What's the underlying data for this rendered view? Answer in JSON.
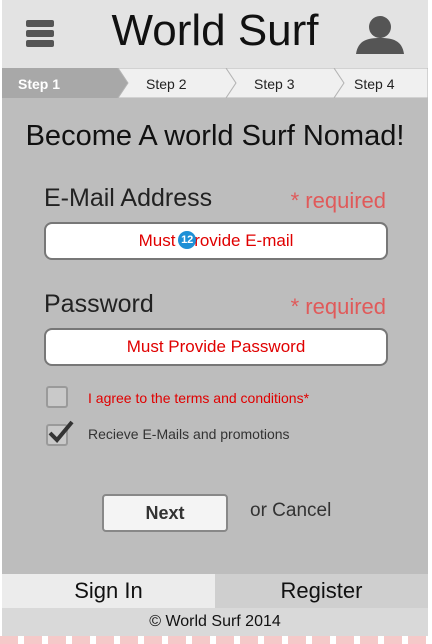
{
  "header": {
    "title": "World Surf"
  },
  "steps": [
    {
      "label": "Step 1",
      "active": true
    },
    {
      "label": "Step 2",
      "active": false
    },
    {
      "label": "Step 3",
      "active": false
    },
    {
      "label": "Step 4",
      "active": false
    }
  ],
  "form": {
    "headline": "Become A world Surf Nomad!",
    "email": {
      "label": "E-Mail Address",
      "required": "* required",
      "value_before": "Must",
      "badge": "12",
      "value_after": "rovide E-mail"
    },
    "password": {
      "label": "Password",
      "required": "* required",
      "value": "Must Provide Password"
    },
    "terms": {
      "label": "I agree to the terms and conditions*",
      "checked": false
    },
    "promos": {
      "label": "Recieve E-Mails and promotions",
      "checked": true
    },
    "next_label": "Next",
    "cancel_label": "or Cancel"
  },
  "tabs": {
    "signin": "Sign In",
    "register": "Register"
  },
  "footer": {
    "copyright": "© World Surf 2014"
  },
  "colors": {
    "error_red": "#e00000",
    "required_red": "#e05a5a",
    "badge_blue": "#1e90d6"
  }
}
